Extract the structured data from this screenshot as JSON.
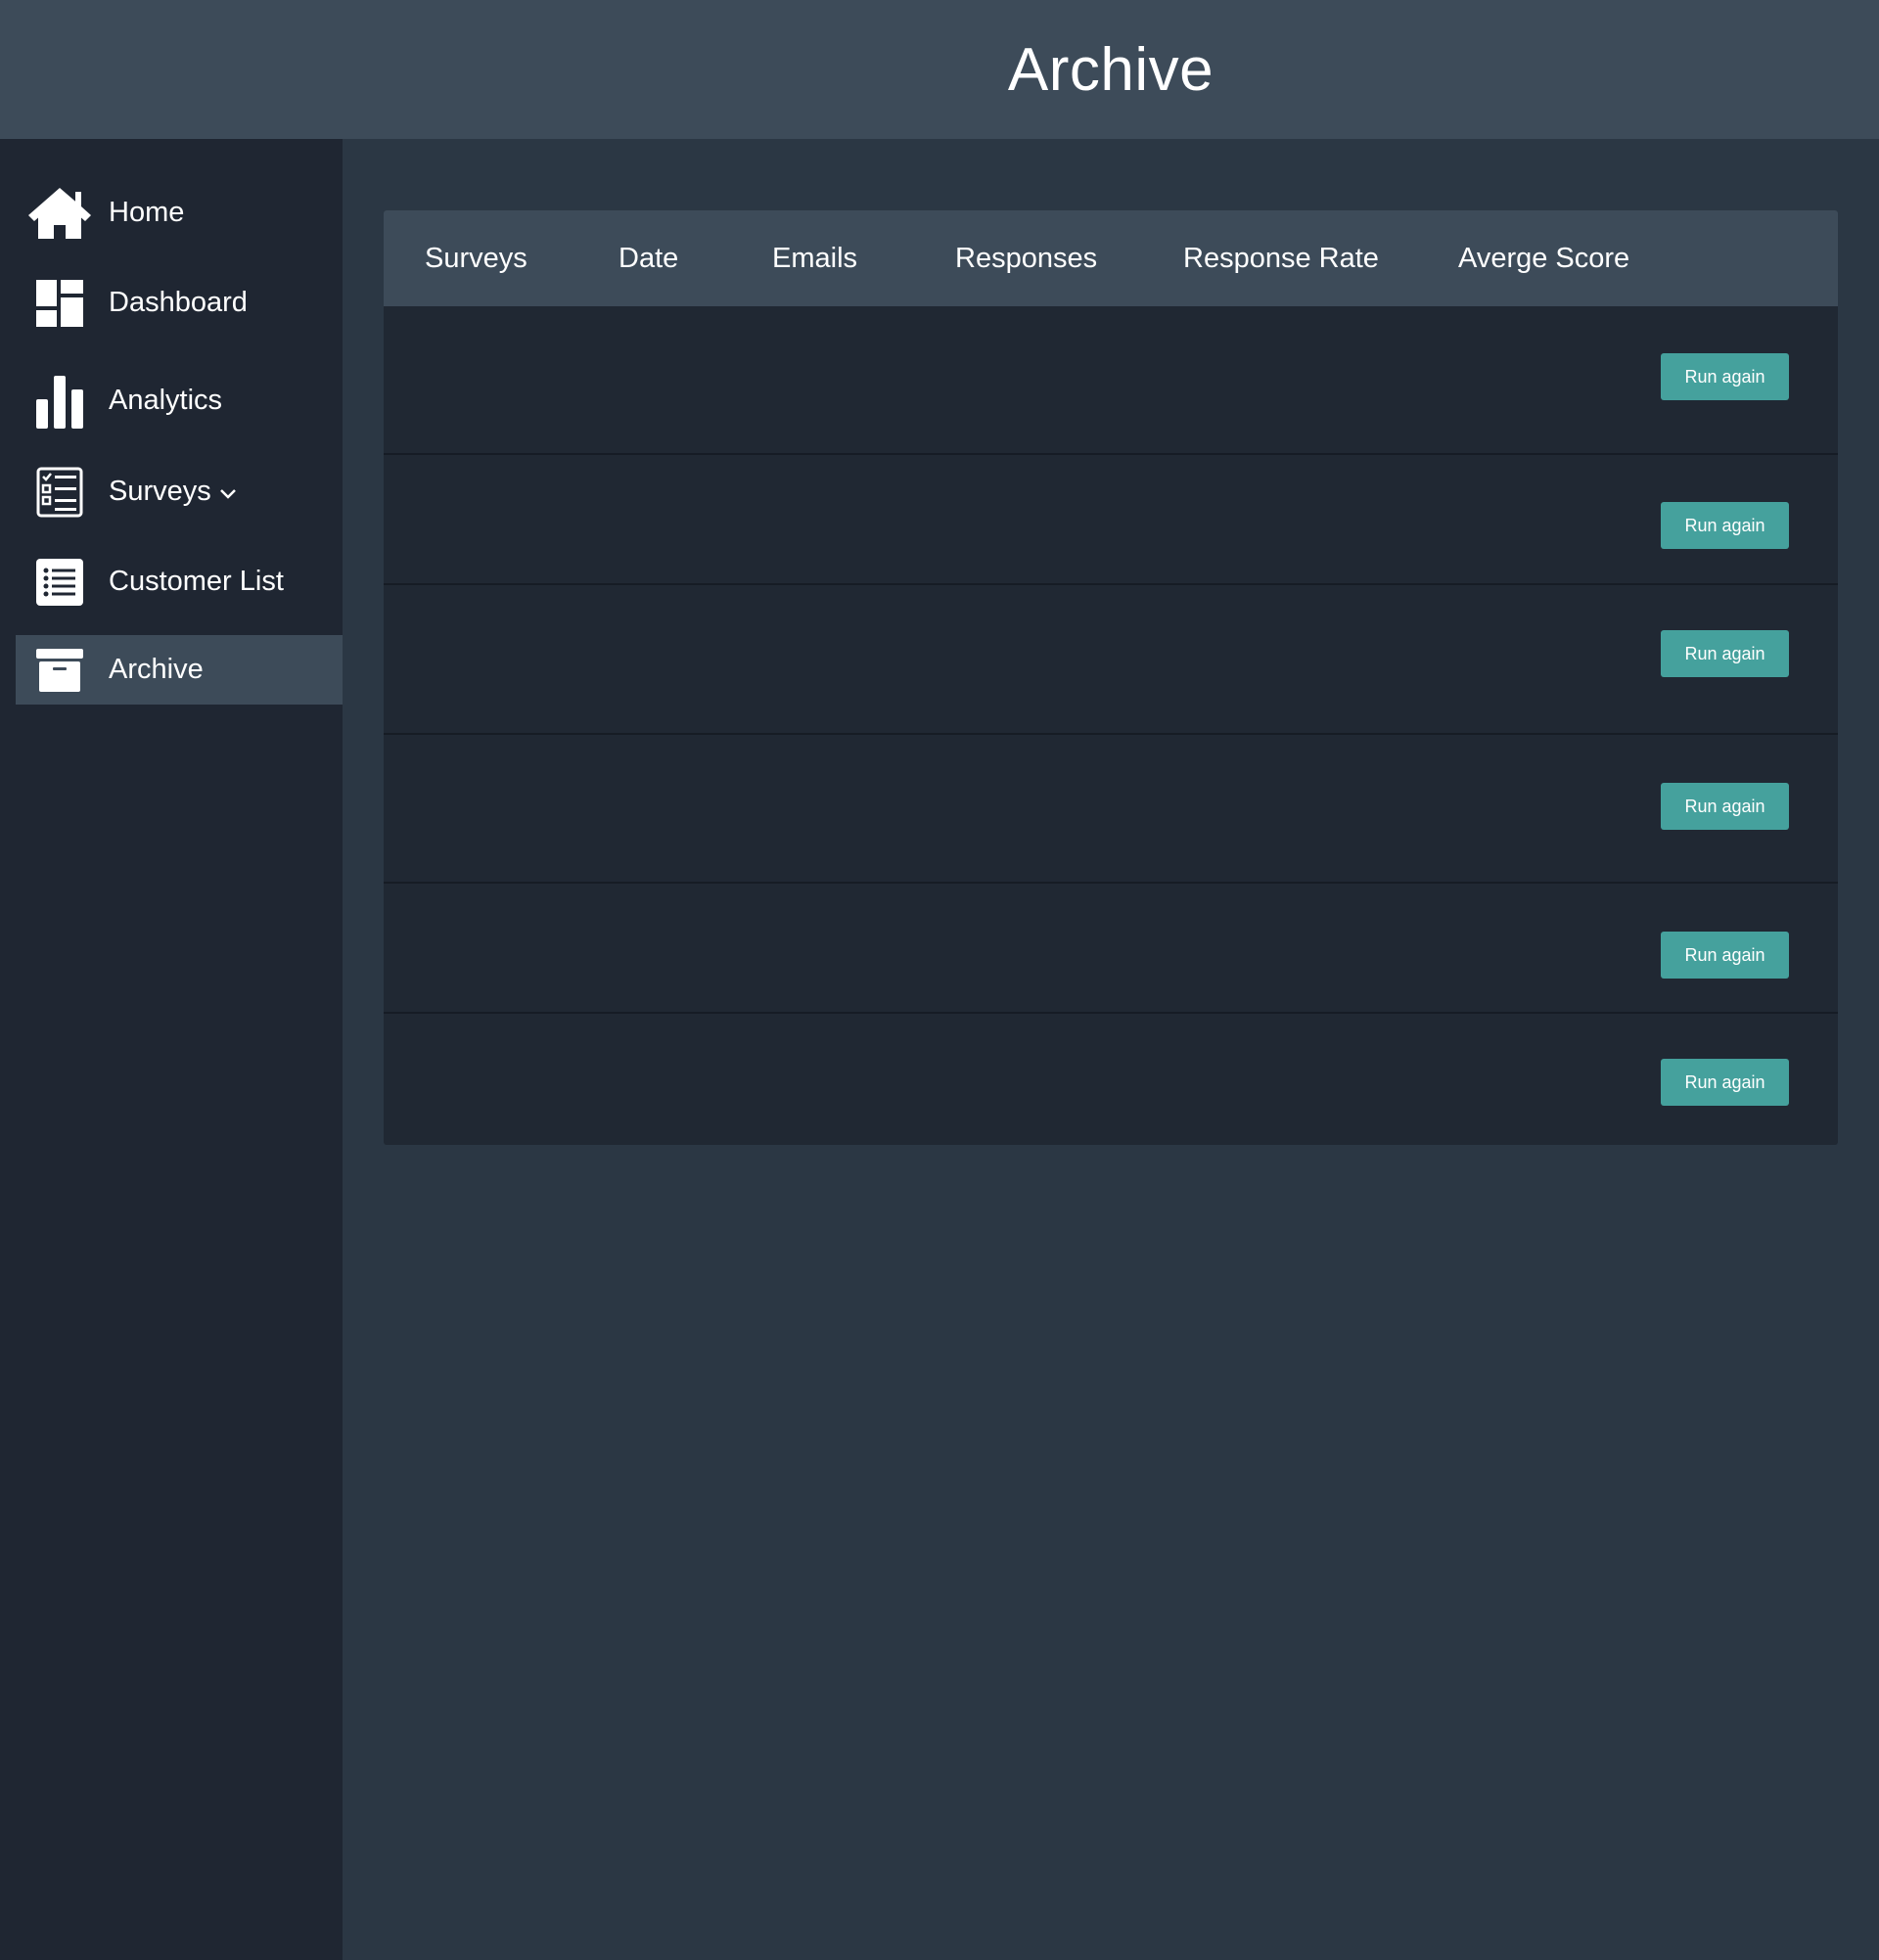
{
  "header": {
    "title": "Archive"
  },
  "sidebar": {
    "items": [
      {
        "label": "Home",
        "icon": "home-icon"
      },
      {
        "label": "Dashboard",
        "icon": "dashboard-icon"
      },
      {
        "label": "Analytics",
        "icon": "bar-chart-icon"
      },
      {
        "label": "Surveys",
        "icon": "checklist-icon",
        "has_dropdown": true
      },
      {
        "label": "Customer List",
        "icon": "list-icon"
      },
      {
        "label": "Archive",
        "icon": "archive-icon",
        "active": true
      }
    ]
  },
  "table": {
    "columns": [
      "Surveys",
      "Date",
      "Emails",
      "Responses",
      "Response Rate",
      "Averge Score"
    ],
    "rows": [
      {
        "action_label": "Run again"
      },
      {
        "action_label": "Run again"
      },
      {
        "action_label": "Run again"
      },
      {
        "action_label": "Run again"
      },
      {
        "action_label": "Run again"
      },
      {
        "action_label": "Run again"
      }
    ]
  },
  "colors": {
    "header_bg": "#3d4b59",
    "sidebar_bg": "#1f2632",
    "content_bg": "#2b3744",
    "table_bg": "#202833",
    "accent": "#45a19d"
  }
}
